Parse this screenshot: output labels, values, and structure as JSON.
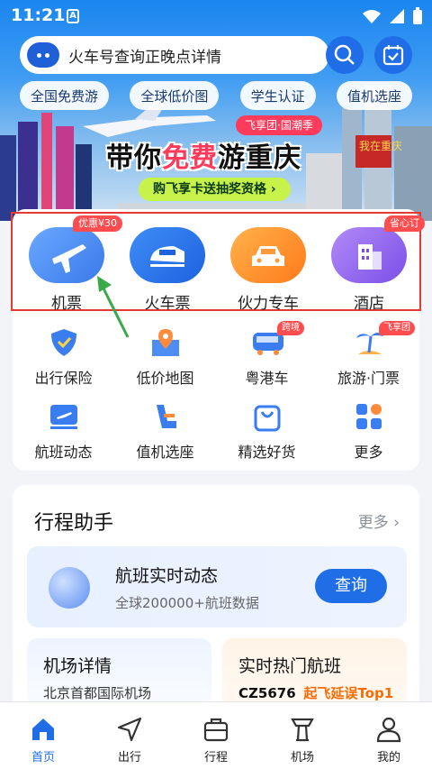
{
  "status": {
    "time": "11:21",
    "notif": "A"
  },
  "search": {
    "placeholder": "火车号查询正晚点详情"
  },
  "chips": [
    "全国免费游",
    "全球低价图",
    "学生认证",
    "值机选座"
  ],
  "banner": {
    "tag": "飞享团·国潮季",
    "title_a": "带你",
    "title_hl": "免费",
    "title_b": "游重庆",
    "cta": "购飞享卡送抽奖资格 ›",
    "sign": "我在重庆"
  },
  "tiles": [
    {
      "label": "机票",
      "badge": "优惠¥30",
      "icon": "plane-icon",
      "color": "#4d8ef5"
    },
    {
      "label": "火车票",
      "badge": "",
      "icon": "train-icon",
      "color": "#2f7ef0"
    },
    {
      "label": "伙力专车",
      "badge": "",
      "icon": "car-icon",
      "color": "#ff9a3c"
    },
    {
      "label": "酒店",
      "badge": "省心订",
      "icon": "hotel-icon",
      "color": "#9a6cf0"
    }
  ],
  "services": [
    {
      "label": "出行保险",
      "badge": "",
      "icon": "shield-icon"
    },
    {
      "label": "低价地图",
      "badge": "",
      "icon": "map-pin-icon"
    },
    {
      "label": "粤港车",
      "badge": "跨境",
      "icon": "bus-icon"
    },
    {
      "label": "旅游·门票",
      "badge": "飞享团",
      "icon": "palm-tree-icon"
    },
    {
      "label": "航班动态",
      "badge": "",
      "icon": "flight-board-icon"
    },
    {
      "label": "值机选座",
      "badge": "",
      "icon": "seat-icon"
    },
    {
      "label": "精选好货",
      "badge": "",
      "icon": "shopping-bag-icon"
    },
    {
      "label": "更多",
      "badge": "",
      "icon": "grid-icon"
    }
  ],
  "itinerary": {
    "title": "行程助手",
    "more": "更多 ›",
    "flight_title": "航班实时动态",
    "flight_sub": "全球200000+航班数据",
    "query": "查询",
    "airport_title": "机场详情",
    "airport_sub": "北京首都国际机场",
    "hot_title": "实时热门航班",
    "hot_no": "CZ5676",
    "hot_tag": "起飞延误Top1"
  },
  "tabs": [
    {
      "label": "首页",
      "icon": "home-icon",
      "active": true
    },
    {
      "label": "出行",
      "icon": "navigation-icon",
      "active": false
    },
    {
      "label": "行程",
      "icon": "luggage-icon",
      "active": false
    },
    {
      "label": "机场",
      "icon": "airport-tower-icon",
      "active": false
    },
    {
      "label": "我的",
      "icon": "user-icon",
      "active": false
    }
  ],
  "colors": {
    "accent": "#1f6ee8",
    "highlight_box": "#e53935",
    "badge": "#ff4d4f",
    "arrow": "#3aa94a"
  }
}
